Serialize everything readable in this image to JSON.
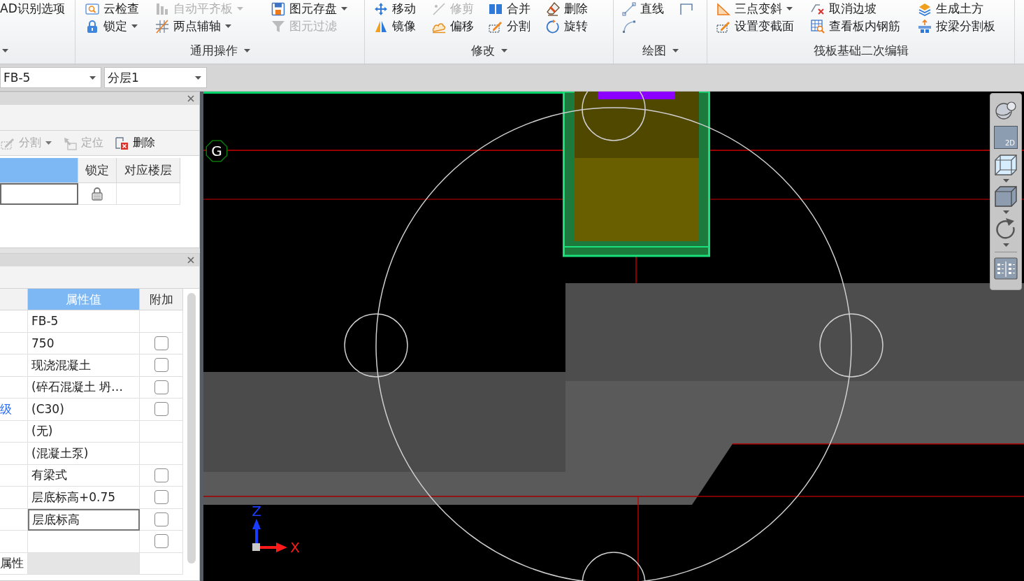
{
  "ribbon": {
    "groups": [
      {
        "dropdown": true,
        "rows": [
          [
            {
              "label": "AD识别选项",
              "disabled": false,
              "dropdown": false
            }
          ]
        ]
      },
      {
        "label": "通用操作",
        "dropdown": true,
        "rows": [
          [
            {
              "label": "云检查",
              "disabled": false,
              "dropdown": false
            },
            {
              "label": "自动平齐板",
              "disabled": true,
              "dropdown": true
            },
            {
              "label": "图元存盘",
              "disabled": false,
              "dropdown": true
            }
          ],
          [
            {
              "label": "锁定",
              "disabled": false,
              "dropdown": true
            },
            {
              "label": "两点辅轴",
              "disabled": false,
              "dropdown": true
            },
            {
              "label": "图元过滤",
              "disabled": true,
              "dropdown": false
            }
          ]
        ]
      },
      {
        "label": "修改",
        "dropdown": true,
        "rows": [
          [
            {
              "label": "移动",
              "disabled": false,
              "dropdown": false
            },
            {
              "label": "修剪",
              "disabled": true,
              "dropdown": false
            },
            {
              "label": "合并",
              "disabled": false,
              "dropdown": false
            },
            {
              "label": "删除",
              "disabled": false,
              "dropdown": false
            }
          ],
          [
            {
              "label": "镜像",
              "disabled": false,
              "dropdown": false
            },
            {
              "label": "偏移",
              "disabled": false,
              "dropdown": false
            },
            {
              "label": "分割",
              "disabled": false,
              "dropdown": false
            },
            {
              "label": "旋转",
              "disabled": false,
              "dropdown": false
            }
          ]
        ]
      },
      {
        "label": "绘图",
        "dropdown": true,
        "rows": [
          [
            {
              "label": "直线",
              "disabled": false,
              "dropdown": false
            },
            {
              "disabled": false,
              "dropdown": false
            }
          ],
          [
            {
              "disabled": false,
              "dropdown": false
            }
          ]
        ]
      },
      {
        "label": "筏板基础二次编辑",
        "dropdown": false,
        "rows": [
          [
            {
              "label": "三点变斜",
              "disabled": false,
              "dropdown": true
            },
            {
              "label": "取消边坡",
              "disabled": false,
              "dropdown": false
            },
            {
              "label": "生成土方",
              "disabled": false,
              "dropdown": false
            }
          ],
          [
            {
              "label": "设置变截面",
              "disabled": false,
              "dropdown": false
            },
            {
              "label": "查看板内钢筋",
              "disabled": false,
              "dropdown": false
            },
            {
              "label": "按梁分割板",
              "disabled": false,
              "dropdown": false
            }
          ]
        ]
      }
    ]
  },
  "selectors": [
    {
      "value": "FB-5"
    },
    {
      "value": "分层1"
    }
  ],
  "layer_panel": {
    "toolbar": [
      {
        "label": "分割",
        "disabled": true,
        "dropdown": true
      },
      {
        "label": "定位",
        "disabled": true,
        "dropdown": false
      },
      {
        "label": "删除",
        "disabled": false,
        "dropdown": false
      }
    ],
    "columns": [
      {
        "selected": true
      },
      {
        "label": "锁定",
        "selected": false
      },
      {
        "label": "对应楼层",
        "selected": false
      }
    ],
    "rows": [
      {
        "locked": true,
        "focused": true
      }
    ]
  },
  "property_panel": {
    "columns": [
      {
        "selected": false
      },
      {
        "label": "属性值",
        "selected": true
      },
      {
        "label": "附加",
        "selected": false
      }
    ],
    "rows": [
      {
        "kind": "value",
        "value": "FB-5",
        "editing": false,
        "checkbox": false
      },
      {
        "kind": "value",
        "value": "750",
        "editing": false,
        "checkbox": true,
        "checked": false
      },
      {
        "kind": "value",
        "value": "现浇混凝土",
        "editing": false,
        "checkbox": true,
        "checked": false
      },
      {
        "kind": "value",
        "value": "(碎石混凝土 坍…",
        "editing": false,
        "checkbox": true,
        "checked": false
      },
      {
        "kind": "value",
        "name": "级",
        "color": "#2a6ef5",
        "value": "(C30)",
        "editing": false,
        "checkbox": true,
        "checked": false
      },
      {
        "kind": "value",
        "value": "(无)",
        "editing": false,
        "checkbox": false
      },
      {
        "kind": "value",
        "value": "(混凝土泵)",
        "editing": false,
        "checkbox": false
      },
      {
        "kind": "value",
        "value": "有梁式",
        "editing": false,
        "checkbox": true,
        "checked": false
      },
      {
        "kind": "value",
        "value": "层底标高+0.75",
        "editing": false,
        "checkbox": true,
        "checked": false
      },
      {
        "kind": "value",
        "value": "层底标高",
        "editing": true,
        "checkbox": true,
        "checked": false
      },
      {
        "kind": "value",
        "editing": false,
        "checkbox": true,
        "checked": false
      },
      {
        "kind": "section",
        "name": "属性"
      }
    ]
  },
  "canvas": {
    "grid_labels": [
      "G"
    ],
    "axis_labels": {
      "vertical": "Z",
      "horizontal": "X"
    }
  },
  "view_toolbar": {
    "items": [
      {
        "dropdown": false
      },
      {
        "label": "2D",
        "dropdown": false
      },
      {
        "dropdown": true
      },
      {
        "dropdown": true
      },
      {
        "dropdown": true
      },
      {
        "dropdown": false
      }
    ]
  }
}
